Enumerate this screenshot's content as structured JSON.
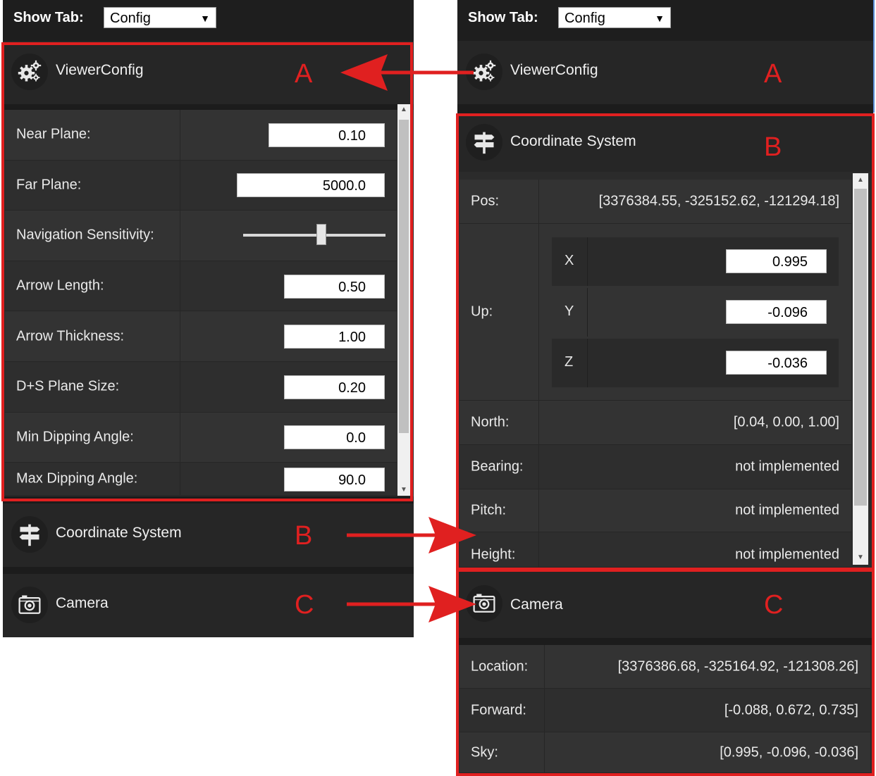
{
  "show_tab": {
    "label": "Show Tab:",
    "value": "Config"
  },
  "sections": {
    "viewer_config": {
      "title": "ViewerConfig",
      "tag": "A"
    },
    "coordinate_system": {
      "title": "Coordinate System",
      "tag": "B"
    },
    "camera": {
      "title": "Camera",
      "tag": "C"
    }
  },
  "viewer_config_rows": [
    {
      "label": "Near Plane:",
      "value": "0.10"
    },
    {
      "label": "Far Plane:",
      "value": "5000.0"
    },
    {
      "label": "Navigation Sensitivity:",
      "slider_level": 0.55
    },
    {
      "label": "Arrow Length:",
      "value": "0.50"
    },
    {
      "label": "Arrow Thickness:",
      "value": "1.00"
    },
    {
      "label": "D+S Plane Size:",
      "value": "0.20"
    },
    {
      "label": "Min Dipping Angle:",
      "value": "0.0"
    },
    {
      "label": "Max Dipping Angle:",
      "value": "90.0"
    }
  ],
  "coordinate_rows": {
    "pos": {
      "label": "Pos:",
      "value": "[3376384.55, -325152.62, -121294.18]"
    },
    "up": {
      "label": "Up:",
      "x_label": "X",
      "x": "0.995",
      "y_label": "Y",
      "y": "-0.096",
      "z_label": "Z",
      "z": "-0.036"
    },
    "north": {
      "label": "North:",
      "value": "[0.04, 0.00, 1.00]"
    },
    "bearing": {
      "label": "Bearing:",
      "value": "not implemented"
    },
    "pitch": {
      "label": "Pitch:",
      "value": "not implemented"
    },
    "height": {
      "label": "Height:",
      "value": "not implemented"
    }
  },
  "camera_rows": {
    "location": {
      "label": "Location:",
      "value": "[3376386.68, -325164.92, -121308.26]"
    },
    "forward": {
      "label": "Forward:",
      "value": "[-0.088, 0.672, 0.735]"
    },
    "sky": {
      "label": "Sky:",
      "value": "[0.995, -0.096, -0.036]"
    }
  },
  "colors": {
    "panel": "#2b2b2b",
    "header": "#262626",
    "row": "#333333",
    "annotation": "#e02020"
  },
  "icons": {
    "viewer_config": "gears-icon",
    "coordinate_system": "signpost-icon",
    "camera": "camera-icon"
  }
}
